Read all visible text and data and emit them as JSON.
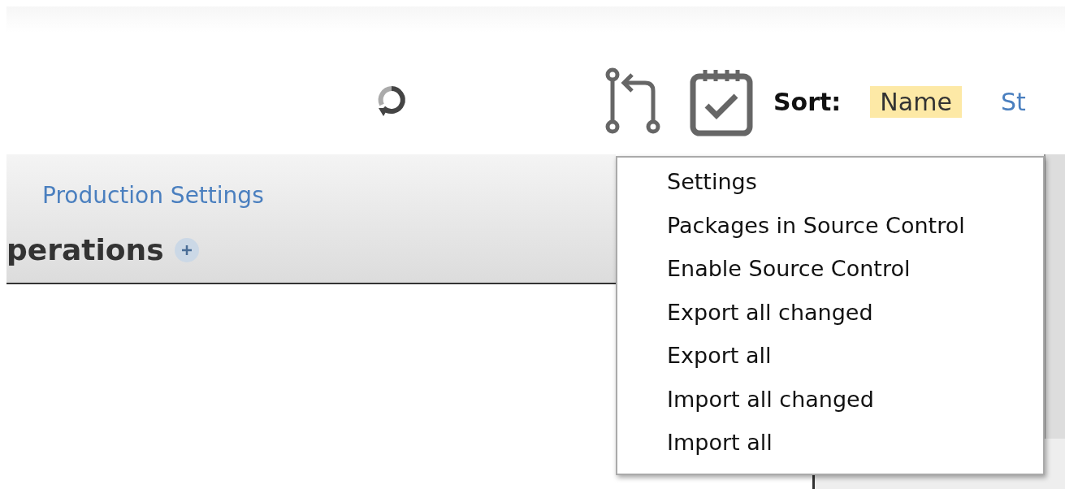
{
  "toolbar": {
    "sort_label": "Sort:",
    "sort_options": [
      {
        "label": "Name",
        "selected": true
      },
      {
        "label": "St",
        "selected": false
      }
    ]
  },
  "header": {
    "link": "Production Settings",
    "section_title": "perations"
  },
  "menu": {
    "items": [
      {
        "label": "Settings"
      },
      {
        "label": "Packages in Source Control"
      },
      {
        "label": "Enable Source Control"
      },
      {
        "label": "Export all changed"
      },
      {
        "label": "Export all"
      },
      {
        "label": "Import all changed"
      },
      {
        "label": "Import all"
      }
    ]
  }
}
